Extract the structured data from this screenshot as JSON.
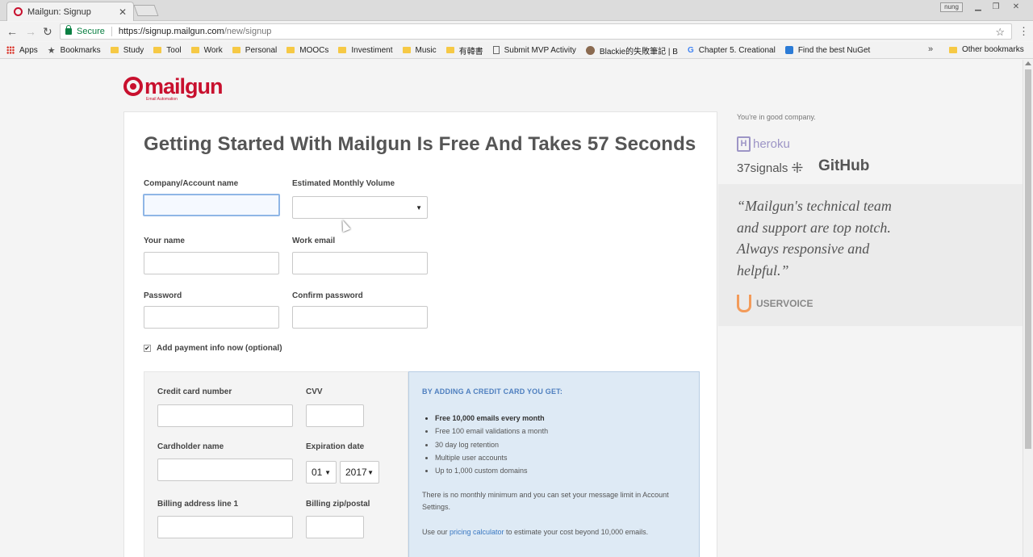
{
  "browser": {
    "tab_title": "Mailgun: Signup",
    "tab_close": "✕",
    "user_badge": "nung",
    "secure_label": "Secure",
    "url_host": "https://signup.mailgun.com",
    "url_path": "/new/signup"
  },
  "bookmarks": {
    "items": [
      "Apps",
      "Bookmarks",
      "Study",
      "Tool",
      "Work",
      "Personal",
      "MOOCs",
      "Investiment",
      "Music",
      "有韓書",
      "Submit MVP Activity",
      "Blackie的失敗筆記 | B",
      "Chapter 5. Creational",
      "Find the best NuGet"
    ],
    "overflow": "»",
    "other": "Other bookmarks"
  },
  "logo": {
    "word": "mailgun",
    "tagline": "Email Automation"
  },
  "form": {
    "headline": "Getting Started With Mailgun Is Free And Takes 57 Seconds",
    "company_label": "Company/Account name",
    "volume_label": "Estimated Monthly Volume",
    "volume_value": "",
    "name_label": "Your name",
    "email_label": "Work email",
    "password_label": "Password",
    "confirm_label": "Confirm password",
    "payment_check_label": "Add payment info now (optional)",
    "payment_checked": true
  },
  "payment": {
    "card_label": "Credit card number",
    "cvv_label": "CVV",
    "holder_label": "Cardholder name",
    "expiry_label": "Expiration date",
    "expiry_month": "01",
    "expiry_year": "2017",
    "billing_label": "Billing address line 1",
    "zip_label": "Billing zip/postal"
  },
  "benefits": {
    "title": "BY ADDING A CREDIT CARD YOU GET:",
    "items": [
      "Free 10,000 emails every month",
      "Free 100 email validations a month",
      "30 day log retention",
      "Multiple user accounts",
      "Up to 1,000 custom domains"
    ],
    "para1": "There is no monthly minimum and you can set your message limit in Account Settings.",
    "para2_pre": "Use our ",
    "para2_link": "pricing calculator",
    "para2_post": " to estimate your cost beyond 10,000 emails."
  },
  "sidebar": {
    "company_note": "You're in good company.",
    "heroku": "heroku",
    "signals": "37signals",
    "github": "GitHub",
    "quote": "“Mailgun's technical team and support are top notch. Always responsive and helpful.”",
    "uservoice": "USERVOICE"
  },
  "colors": {
    "brand": "#c8102e",
    "accent_blue": "#4e7fbf",
    "benefit_bg": "#deeaf5"
  }
}
